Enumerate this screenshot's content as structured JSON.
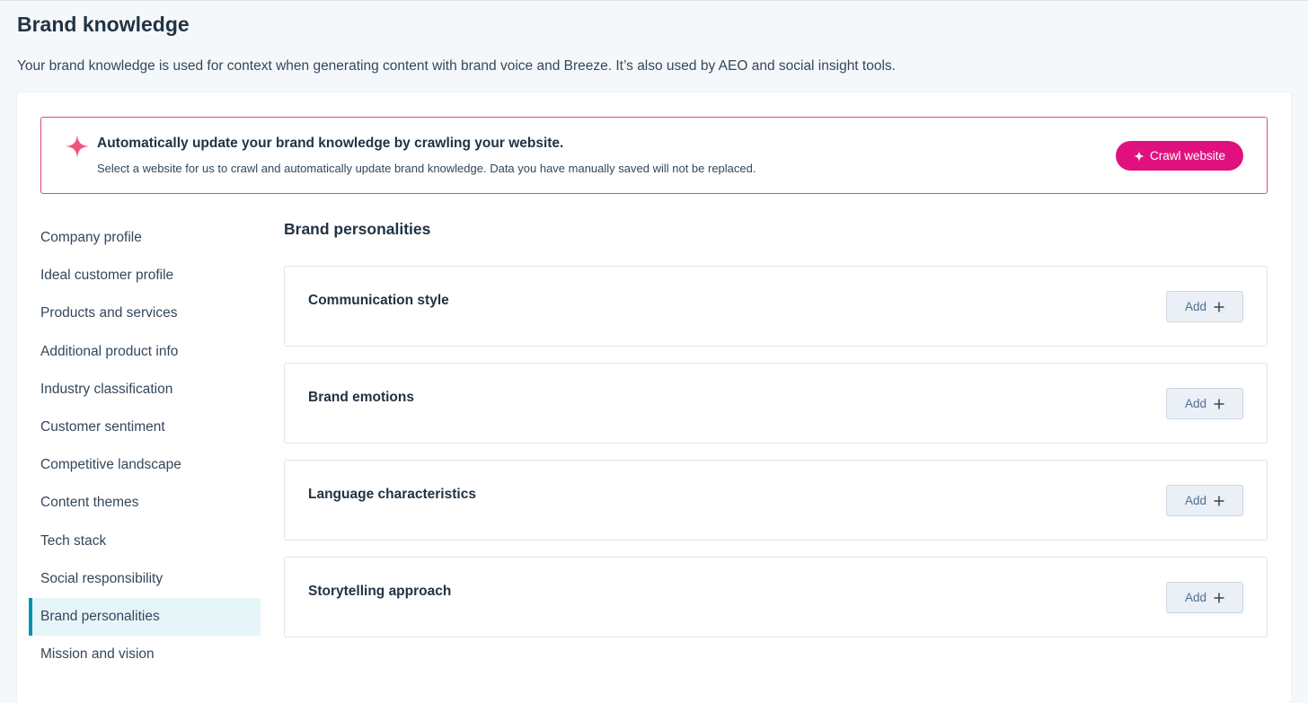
{
  "page": {
    "title": "Brand knowledge",
    "description": "Your brand knowledge is used for context when generating content with brand voice and Breeze. It’s also used by AEO and social insight tools."
  },
  "banner": {
    "icon": "sparkle-icon",
    "title": "Automatically update your brand knowledge by crawling your website.",
    "subtitle": "Select a website for us to crawl and automatically update brand knowledge. Data you have manually saved will not be replaced.",
    "button_label": "Crawl website",
    "accent_color": "#e0117f",
    "border_color": "#e0477a"
  },
  "sidebar": {
    "active_color": "#0091ae",
    "items": [
      {
        "label": "Company profile",
        "active": false
      },
      {
        "label": "Ideal customer profile",
        "active": false
      },
      {
        "label": "Products and services",
        "active": false
      },
      {
        "label": "Additional product info",
        "active": false
      },
      {
        "label": "Industry classification",
        "active": false
      },
      {
        "label": "Customer sentiment",
        "active": false
      },
      {
        "label": "Competitive landscape",
        "active": false
      },
      {
        "label": "Content themes",
        "active": false
      },
      {
        "label": "Tech stack",
        "active": false
      },
      {
        "label": "Social responsibility",
        "active": false
      },
      {
        "label": "Brand personalities",
        "active": true
      },
      {
        "label": "Mission and vision",
        "active": false
      }
    ]
  },
  "main": {
    "section_title": "Brand personalities",
    "add_label": "Add",
    "rows": [
      {
        "label": "Communication style"
      },
      {
        "label": "Brand emotions"
      },
      {
        "label": "Language characteristics"
      },
      {
        "label": "Storytelling approach"
      }
    ]
  }
}
